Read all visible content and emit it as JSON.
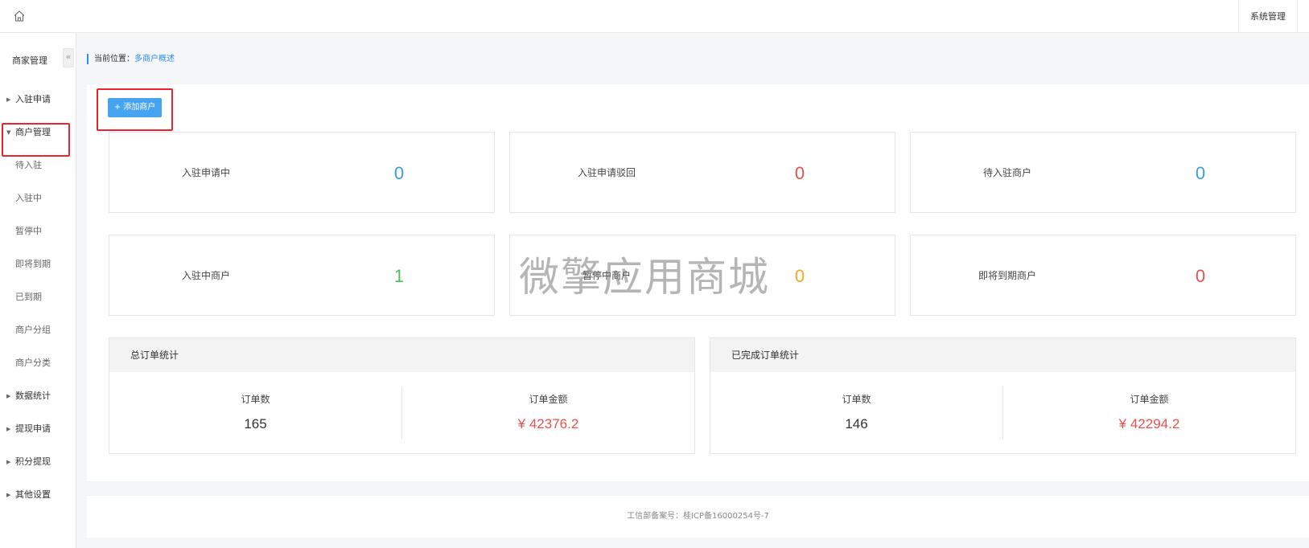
{
  "header": {
    "home_icon": "home-icon",
    "system_label": "系统管理"
  },
  "sidebar": {
    "title": "商家管理",
    "collapse_glyph": "«",
    "items": [
      {
        "label": "入驻申请",
        "type": "group",
        "expanded": false
      },
      {
        "label": "商户管理",
        "type": "group",
        "expanded": true
      },
      {
        "label": "待入驻",
        "type": "sub"
      },
      {
        "label": "入驻中",
        "type": "sub"
      },
      {
        "label": "暂停中",
        "type": "sub"
      },
      {
        "label": "即将到期",
        "type": "sub"
      },
      {
        "label": "已到期",
        "type": "sub"
      },
      {
        "label": "商户分组",
        "type": "sub"
      },
      {
        "label": "商户分类",
        "type": "sub"
      },
      {
        "label": "数据统计",
        "type": "group",
        "expanded": false
      },
      {
        "label": "提现申请",
        "type": "group",
        "expanded": false
      },
      {
        "label": "积分提现",
        "type": "group",
        "expanded": false
      },
      {
        "label": "其他设置",
        "type": "group",
        "expanded": false
      }
    ]
  },
  "breadcrumb": {
    "prefix": "当前位置：",
    "current": "多商户概述"
  },
  "main": {
    "add_button": "+ 添加商户",
    "stats": [
      {
        "label": "入驻申请中",
        "value": "0",
        "color": "#3a9de8"
      },
      {
        "label": "入驻申请驳回",
        "value": "0",
        "color": "#e8514f"
      },
      {
        "label": "待入驻商户",
        "value": "0",
        "color": "#3a9de8"
      },
      {
        "label": "入驻中商户",
        "value": "1",
        "color": "#4cc35a"
      },
      {
        "label": "暂停中商户",
        "value": "0",
        "color": "#f5a623"
      },
      {
        "label": "即将到期商户",
        "value": "0",
        "color": "#e8514f"
      }
    ],
    "order_panels": [
      {
        "title": "总订单统计",
        "count_label": "订单数",
        "count_value": "165",
        "amount_label": "订单金额",
        "amount_value": "¥ 42376.2"
      },
      {
        "title": "已完成订单统计",
        "count_label": "订单数",
        "count_value": "146",
        "amount_label": "订单金额",
        "amount_value": "¥ 42294.2"
      }
    ],
    "amount_color": "#e8514f"
  },
  "watermark": "微擎应用商城",
  "footer": {
    "text": "工信部备案号：桂ICP备16000254号-7"
  }
}
